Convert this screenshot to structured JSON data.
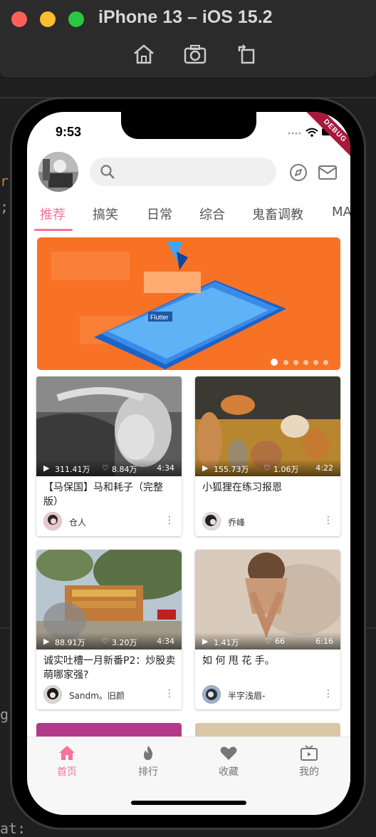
{
  "simulator": {
    "title": "iPhone 13 – iOS 15.2",
    "buttons": [
      "home-icon",
      "screenshot-icon",
      "rotate-icon"
    ]
  },
  "status_bar": {
    "time": "9:53",
    "debug_label": "DEBUG"
  },
  "header": {
    "search_placeholder": "",
    "icons": [
      "compass-icon",
      "mail-icon"
    ]
  },
  "tabs": [
    {
      "label": "推荐",
      "active": true
    },
    {
      "label": "搞笑"
    },
    {
      "label": "日常"
    },
    {
      "label": "综合"
    },
    {
      "label": "鬼畜调教"
    },
    {
      "label": "MA"
    }
  ],
  "banner": {
    "text": "Flutter",
    "page_count": 6,
    "active_page": 0
  },
  "videos": [
    {
      "views": "311.41万",
      "likes": "8.84万",
      "duration": "4:34",
      "title": "【马保国】马和耗子（完整版）",
      "author": "仓人"
    },
    {
      "views": "155.73万",
      "likes": "1.06万",
      "duration": "4:22",
      "title": "小狐狸在练习报恩",
      "author": "乔峰"
    },
    {
      "views": "88.91万",
      "likes": "3.20万",
      "duration": "4:34",
      "title": "诚实吐槽一月新番P2：炒股卖萌哪家强?",
      "author": "Sandm。旧颜"
    },
    {
      "views": "1.41万",
      "likes": "66",
      "duration": "6:16",
      "title": "如 何 甩 花 手。",
      "author": "半字浅眉-"
    }
  ],
  "bottom_nav": [
    {
      "label": "首页",
      "icon": "home-icon",
      "active": true
    },
    {
      "label": "排行",
      "icon": "fire-icon"
    },
    {
      "label": "收藏",
      "icon": "heart-icon"
    },
    {
      "label": "我的",
      "icon": "tv-icon"
    }
  ],
  "colors": {
    "accent": "#fb7299",
    "banner": "#f87226"
  }
}
